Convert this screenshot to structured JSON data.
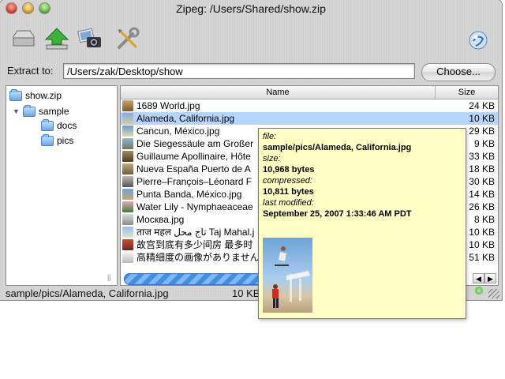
{
  "window": {
    "title": "Zipeg: /Users/Shared/show.zip"
  },
  "toolbar": {
    "buttons": [
      {
        "name": "open-archive",
        "icon": "tray-icon"
      },
      {
        "name": "extract",
        "icon": "green-up-arrow-icon"
      },
      {
        "name": "preview",
        "icon": "camera-photos-icon"
      },
      {
        "name": "options",
        "icon": "tools-icon"
      }
    ],
    "help_icon": "globe-help-icon"
  },
  "extract": {
    "label": "Extract to:",
    "path": "/Users/zak/Desktop/show",
    "choose_label": "Choose..."
  },
  "tree": {
    "items": [
      {
        "label": "show.zip"
      },
      {
        "label": "sample"
      },
      {
        "label": "docs"
      },
      {
        "label": "pics"
      }
    ]
  },
  "filelist": {
    "columns": {
      "name": "Name",
      "size": "Size"
    },
    "rows": [
      {
        "name": "1689 World.jpg",
        "size": "24 KB"
      },
      {
        "name": "Alameda, California.jpg",
        "size": "10 KB"
      },
      {
        "name": "Cancun, México.jpg",
        "size": "29 KB"
      },
      {
        "name": "Die Siegessäule am Großer",
        "size": "9 KB"
      },
      {
        "name": "Guillaume Apollinaire, Hôte",
        "size": "33 KB"
      },
      {
        "name": "Nueva España Puerto de A",
        "size": "18 KB"
      },
      {
        "name": "Pierre–François–Léonard F",
        "size": "30 KB"
      },
      {
        "name": "Punta Banda, México.jpg",
        "size": "14 KB"
      },
      {
        "name": "Water Lily - Nymphaeaceae",
        "size": "26 KB"
      },
      {
        "name": "Москва.jpg",
        "size": "8 KB"
      },
      {
        "name": "ताज महल تاج محل Taj Mahal.j",
        "size": "10 KB"
      },
      {
        "name": "故宫到底有多少间房 最多时",
        "size": "10 KB"
      },
      {
        "name": "高精細度の画像がありません",
        "size": "51 KB"
      }
    ]
  },
  "status": {
    "path": "sample/pics/Alameda, California.jpg",
    "size": "10 KB"
  },
  "tooltip": {
    "file_label": "file:",
    "file_value": "sample/pics/Alameda, California.jpg",
    "size_label": "size:",
    "size_value": "10,968 bytes",
    "compressed_label": "compressed:",
    "compressed_value": "10,811 bytes",
    "modified_label": "last modified:",
    "modified_value": "September 25, 2007 1:33:46 AM PDT"
  },
  "colors": {
    "selection": "#b5d5ff",
    "tooltip_bg": "#ffffc6",
    "folder": "#6ba6e8"
  }
}
